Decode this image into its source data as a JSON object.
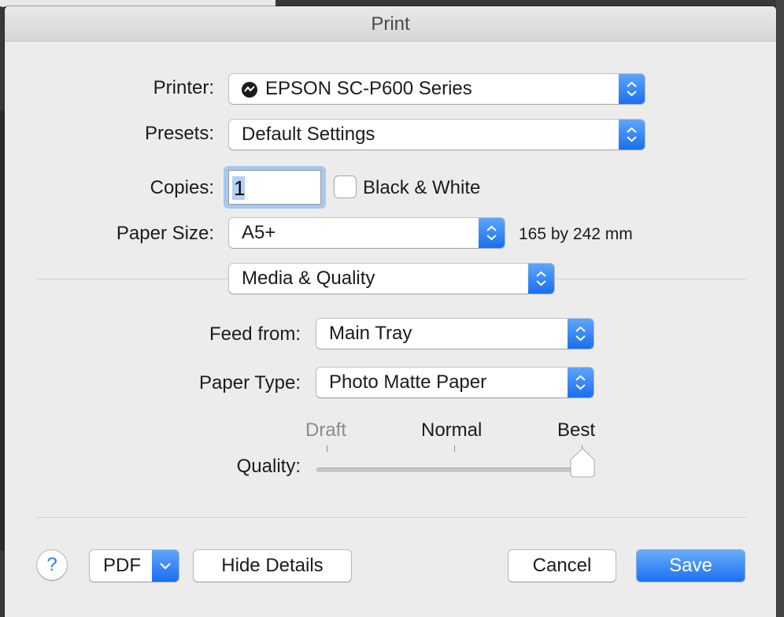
{
  "window": {
    "title": "Print"
  },
  "printer": {
    "label": "Printer:",
    "value": "EPSON SC-P600 Series"
  },
  "presets": {
    "label": "Presets:",
    "value": "Default Settings"
  },
  "copies": {
    "label": "Copies:",
    "value": "1",
    "bw_label": "Black & White",
    "bw_checked": false
  },
  "paper_size": {
    "label": "Paper Size:",
    "value": "A5+",
    "dimensions": "165 by 242 mm"
  },
  "section": {
    "value": "Media & Quality"
  },
  "feed_from": {
    "label": "Feed from:",
    "value": "Main Tray"
  },
  "paper_type": {
    "label": "Paper Type:",
    "value": "Photo Matte Paper"
  },
  "quality": {
    "label": "Quality:",
    "options": [
      "Draft",
      "Normal",
      "Best"
    ],
    "selected": "Best",
    "level": 1.0
  },
  "buttons": {
    "help": "?",
    "pdf": "PDF",
    "hide_details": "Hide Details",
    "cancel": "Cancel",
    "save": "Save"
  },
  "colors": {
    "accent": "#1a6ff0",
    "accent_light": "#5ea5fa",
    "dialog_bg": "#ececec"
  },
  "icons": [
    "printer-status-icon",
    "popup-stepper-icon",
    "chevron-down-icon",
    "help-icon"
  ]
}
